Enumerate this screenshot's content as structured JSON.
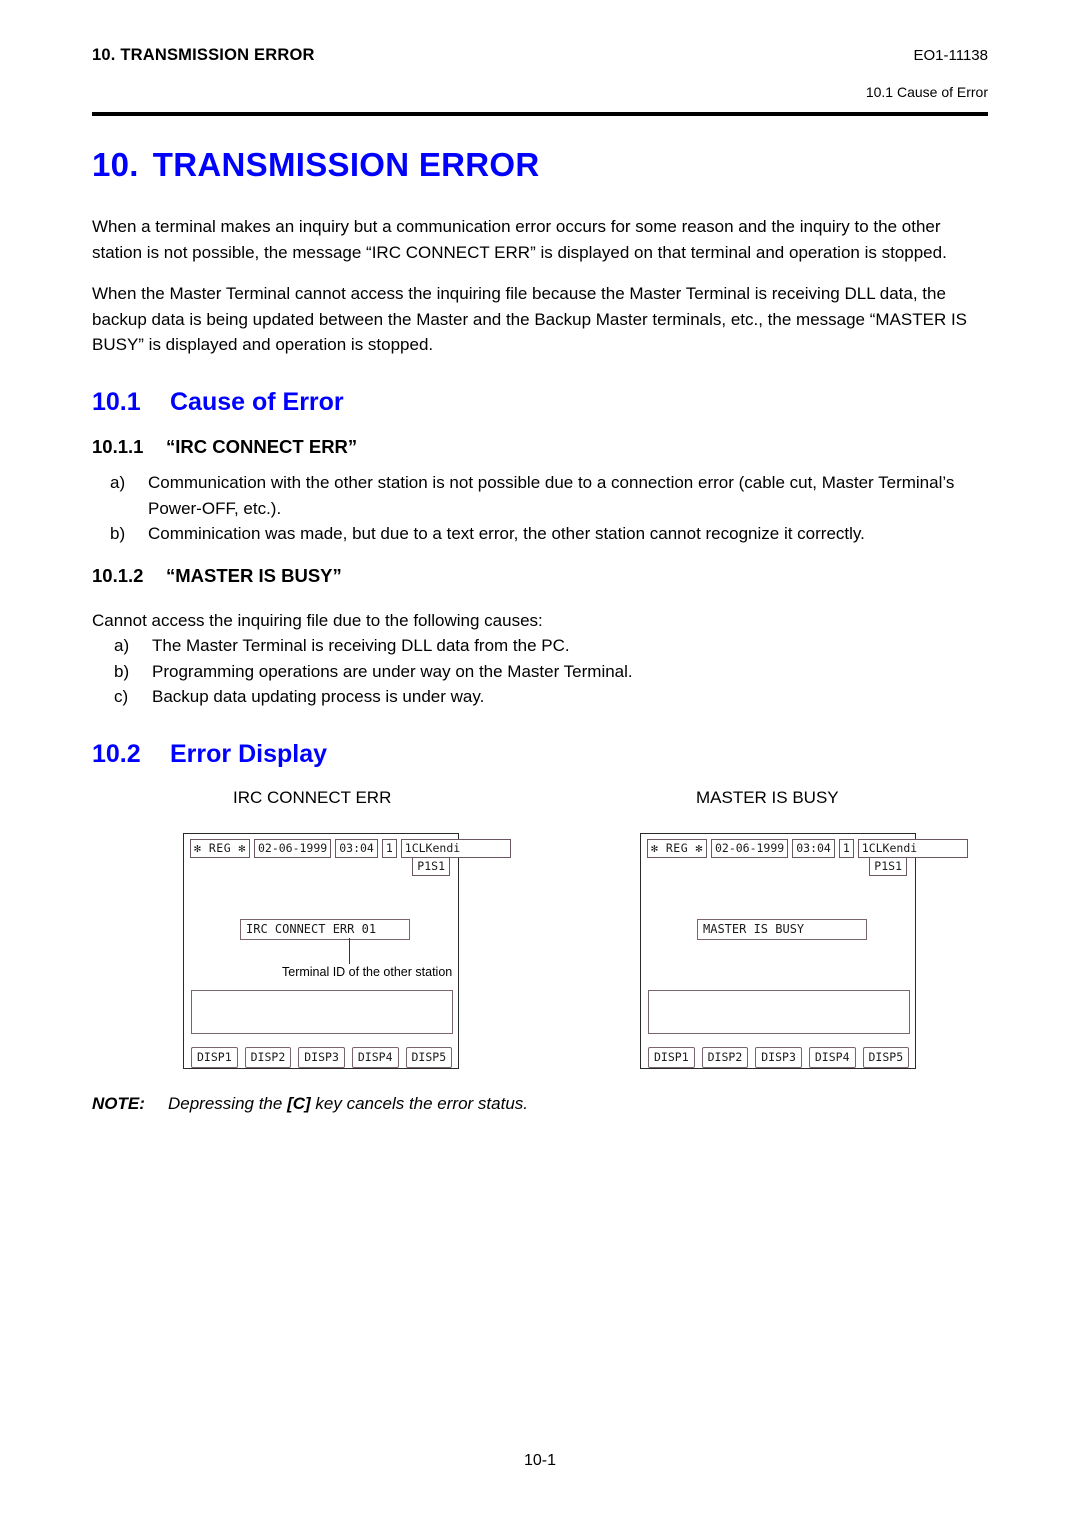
{
  "header": {
    "left_title": "10. TRANSMISSION ERROR",
    "doc_code": "EO1-11138",
    "section_ref": "10.1  Cause of Error"
  },
  "title": {
    "number": "10.",
    "text": "TRANSMISSION ERROR"
  },
  "intro": {
    "paragraph1": "When a terminal makes an inquiry but a communication error occurs for some reason and the inquiry to the other station is not possible, the message “IRC CONNECT ERR” is displayed on that terminal and operation is stopped.",
    "paragraph2": "When the Master Terminal cannot access the inquiring file because the Master Terminal is receiving DLL data, the backup data is being updated between the Master and the Backup Master terminals, etc., the message “MASTER IS BUSY” is displayed and operation is stopped."
  },
  "section_10_1": {
    "number": "10.1",
    "title": "Cause of Error",
    "sub_10_1_1": {
      "number": "10.1.1",
      "title": "“IRC CONNECT ERR”",
      "items": [
        {
          "marker": "a)",
          "text": "Communication with the other station is not possible due to a connection error (cable cut, Master Terminal’s Power-OFF, etc.)."
        },
        {
          "marker": "b)",
          "text": "Comminication was made, but due to a text error, the other station cannot recognize it correctly."
        }
      ]
    },
    "sub_10_1_2": {
      "number": "10.1.2",
      "title": "“MASTER IS BUSY”",
      "lead": "Cannot access the inquiring file due to the following causes:",
      "items": [
        {
          "marker": "a)",
          "text": "The Master Terminal is receiving DLL data from the PC."
        },
        {
          "marker": "b)",
          "text": "Programming operations are under way on the Master Terminal."
        },
        {
          "marker": "c)",
          "text": "Backup data updating process is under way."
        }
      ]
    }
  },
  "section_10_2": {
    "number": "10.2",
    "title": "Error Display",
    "figures": [
      {
        "caption": "IRC CONNECT ERR",
        "status": {
          "mode": "✻ REG ✻",
          "date": "02-06-1999",
          "time": "03:04",
          "terminal": "1",
          "operator": "1CLKendi",
          "page_state": "P1S1"
        },
        "message": "IRC CONNECT ERR 01",
        "annotation": "Terminal ID of the other station",
        "has_annotation": true,
        "disp_keys": [
          "DISP1",
          "DISP2",
          "DISP3",
          "DISP4",
          "DISP5"
        ]
      },
      {
        "caption": "MASTER IS BUSY",
        "status": {
          "mode": "✻ REG ✻",
          "date": "02-06-1999",
          "time": "03:04",
          "terminal": "1",
          "operator": "1CLKendi",
          "page_state": "P1S1"
        },
        "message": "MASTER IS BUSY",
        "annotation": "",
        "has_annotation": false,
        "disp_keys": [
          "DISP1",
          "DISP2",
          "DISP3",
          "DISP4",
          "DISP5"
        ]
      }
    ]
  },
  "note": {
    "label": "NOTE:",
    "text_before": "Depressing the ",
    "key": "[C]",
    "text_after": " key cancels the error status."
  },
  "footer": {
    "page_number": "10-1"
  },
  "colors": {
    "heading_blue": "#0000ff",
    "text_black": "#000000",
    "terminal_border": "#2a2a2a",
    "field_border": "#6b5663"
  }
}
